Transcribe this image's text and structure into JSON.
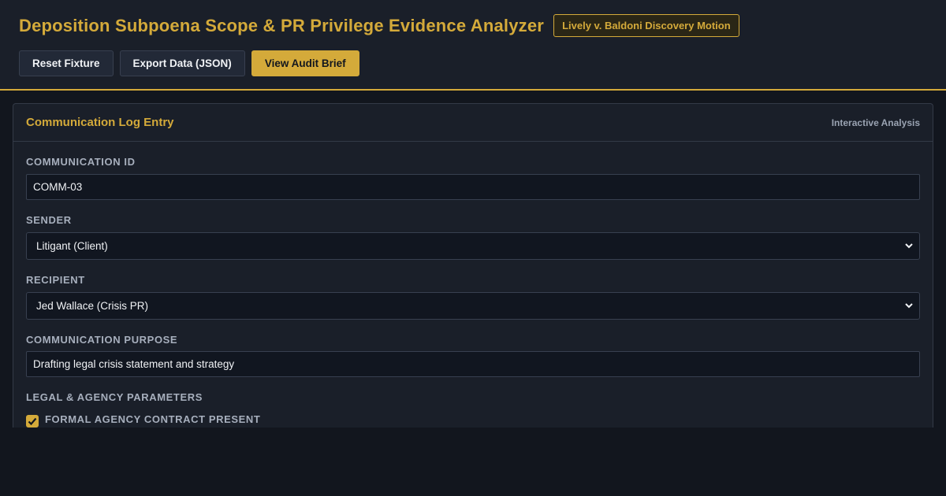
{
  "header": {
    "title": "Deposition Subpoena Scope & PR Privilege Evidence Analyzer",
    "case_badge": "Lively v. Baldoni Discovery Motion",
    "buttons": {
      "reset": "Reset Fixture",
      "export": "Export Data (JSON)",
      "brief": "View Audit Brief"
    }
  },
  "panel": {
    "title": "Communication Log Entry",
    "tag": "Interactive Analysis",
    "fields": {
      "comm_id": {
        "label": "COMMUNICATION ID",
        "value": "COMM-03"
      },
      "sender": {
        "label": "SENDER",
        "value": "Litigant (Client)"
      },
      "recipient": {
        "label": "RECIPIENT",
        "value": "Jed Wallace (Crisis PR)"
      },
      "purpose": {
        "label": "COMMUNICATION PURPOSE",
        "value": "Drafting legal crisis statement and strategy"
      }
    },
    "params_heading": "LEGAL & AGENCY PARAMETERS",
    "agency_contract": {
      "label": "FORMAL AGENCY CONTRACT PRESENT",
      "checked": true
    }
  },
  "colors": {
    "accent": "#d4aa3a",
    "background": "#12161e",
    "panel": "#1a1f29"
  }
}
